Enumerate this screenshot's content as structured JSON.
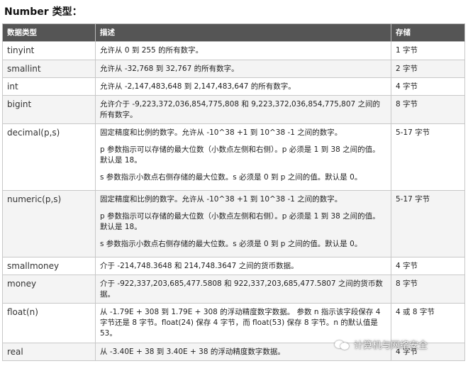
{
  "title": "Number 类型：",
  "headers": [
    "数据类型",
    "描述",
    "存储"
  ],
  "rows": [
    {
      "type": "tinyint",
      "desc": [
        "允许从 0 到 255 的所有数字。"
      ],
      "storage": "1 字节"
    },
    {
      "type": "smallint",
      "desc": [
        "允许从 -32,768 到 32,767 的所有数字。"
      ],
      "storage": "2 字节"
    },
    {
      "type": "int",
      "desc": [
        "允许从 -2,147,483,648 到 2,147,483,647 的所有数字。"
      ],
      "storage": "4 字节"
    },
    {
      "type": "bigint",
      "desc": [
        "允许介于 -9,223,372,036,854,775,808 和 9,223,372,036,854,775,807 之间的所有数字。"
      ],
      "storage": "8 字节"
    },
    {
      "type": "decimal(p,s)",
      "desc": [
        "固定精度和比例的数字。允许从 -10^38 +1 到 10^38 -1 之间的数字。",
        "p 参数指示可以存储的最大位数（小数点左侧和右侧）。p 必须是 1 到 38 之间的值。默认是 18。",
        "s 参数指示小数点右侧存储的最大位数。s 必须是 0 到 p 之间的值。默认是 0。"
      ],
      "storage": "5-17 字节"
    },
    {
      "type": "numeric(p,s)",
      "desc": [
        "固定精度和比例的数字。允许从 -10^38 +1 到 10^38 -1 之间的数字。",
        "p 参数指示可以存储的最大位数（小数点左侧和右侧）。p 必须是 1 到 38 之间的值。默认是 18。",
        "s 参数指示小数点右侧存储的最大位数。s 必须是 0 到 p 之间的值。默认是 0。"
      ],
      "storage": "5-17 字节"
    },
    {
      "type": "smallmoney",
      "desc": [
        "介于 -214,748.3648 和 214,748.3647 之间的货币数据。"
      ],
      "storage": "4 字节"
    },
    {
      "type": "money",
      "desc": [
        "介于 -922,337,203,685,477.5808 和 922,337,203,685,477.5807 之间的货币数据。"
      ],
      "storage": "8 字节"
    },
    {
      "type": "float(n)",
      "desc": [
        "从 -1.79E + 308 到 1.79E + 308 的浮动精度数字数据。 参数 n 指示该字段保存 4 字节还是 8 字节。float(24) 保存 4 字节，而 float(53) 保存 8 字节。n 的默认值是 53。"
      ],
      "storage": "4 或 8 字节"
    },
    {
      "type": "real",
      "desc": [
        "从 -3.40E + 38 到 3.40E + 38 的浮动精度数字数据。"
      ],
      "storage": "4 字节"
    }
  ],
  "watermark": "计算机与网络安全"
}
